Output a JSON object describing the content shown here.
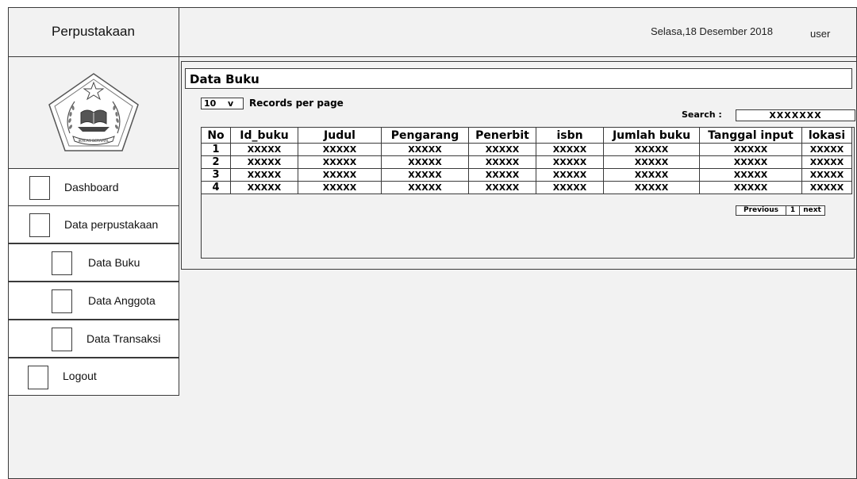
{
  "app": {
    "brand": "Perpustakaan"
  },
  "header": {
    "date": "Selasa,18 Desember 2018",
    "user": "user"
  },
  "sidebar": {
    "items": [
      {
        "label": "Dashboard"
      },
      {
        "label": "Data perpustakaan"
      },
      {
        "label": "Data Buku"
      },
      {
        "label": "Data Anggota"
      },
      {
        "label": "Data Transaksi"
      },
      {
        "label": "Logout"
      }
    ]
  },
  "main": {
    "title": "Data Buku",
    "records_per_page": {
      "value": "10",
      "arrow": "v",
      "label": "Records per page"
    },
    "search": {
      "label": "Search :",
      "value": "XXXXXXX"
    },
    "table": {
      "columns": [
        "No",
        "Id_buku",
        "Judul",
        "Pengarang",
        "Penerbit",
        "isbn",
        "Jumlah buku",
        "Tanggal input",
        "lokasi"
      ],
      "rows": [
        [
          "1",
          "XXXXX",
          "XXXXX",
          "XXXXX",
          "XXXXX",
          "XXXXX",
          "XXXXX",
          "XXXXX",
          "XXXXX"
        ],
        [
          "2",
          "XXXXX",
          "XXXXX",
          "XXXXX",
          "XXXXX",
          "XXXXX",
          "XXXXX",
          "XXXXX",
          "XXXXX"
        ],
        [
          "3",
          "XXXXX",
          "XXXXX",
          "XXXXX",
          "XXXXX",
          "XXXXX",
          "XXXXX",
          "XXXXX",
          "XXXXX"
        ],
        [
          "4",
          "XXXXX",
          "XXXXX",
          "XXXXX",
          "XXXXX",
          "XXXXX",
          "XXXXX",
          "XXXXX",
          "XXXXX"
        ]
      ]
    },
    "pagination": {
      "previous": "Previous",
      "page": "1",
      "next": "next"
    }
  },
  "logo": {
    "icon": "kemenag-emblem-icon",
    "text": "IKHLAS BERAMAL"
  }
}
